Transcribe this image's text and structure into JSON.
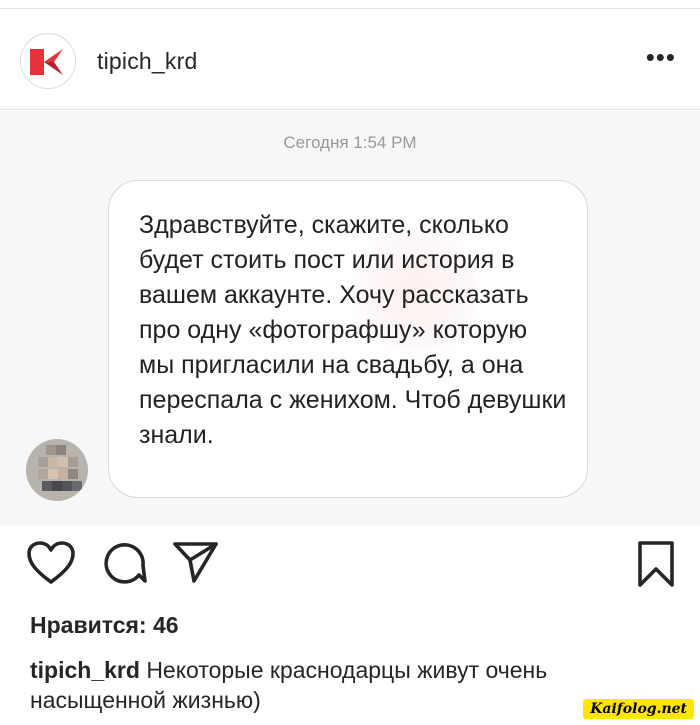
{
  "post": {
    "username": "tipich_krd",
    "more_label": "•••"
  },
  "message": {
    "timestamp": "Сегодня 1:54 PM",
    "text": "Здравствуйте, скажите, сколько будет стоить пост или история в вашем аккаунте. Хочу рассказать про одну «фотографшу» которую мы пригласили на свадьбу, а она переспала с женихом. Чтоб девушки знали."
  },
  "engagement": {
    "likes_label": "Нравится: 46"
  },
  "caption": {
    "username": "tipich_krd",
    "text": "Некоторые краснодарцы живут очень насыщенной жизнью)"
  },
  "watermark": {
    "site": "Kaifolog.net"
  },
  "icons": {
    "like": "heart-icon",
    "comment": "comment-icon",
    "share": "send-icon",
    "save": "bookmark-icon",
    "more": "more-dots-icon"
  },
  "colors": {
    "logo_red": "#e63236",
    "logo_dark": "#b5222a",
    "badge": "#ffe600",
    "chat_bg": "#f7f7f7"
  }
}
